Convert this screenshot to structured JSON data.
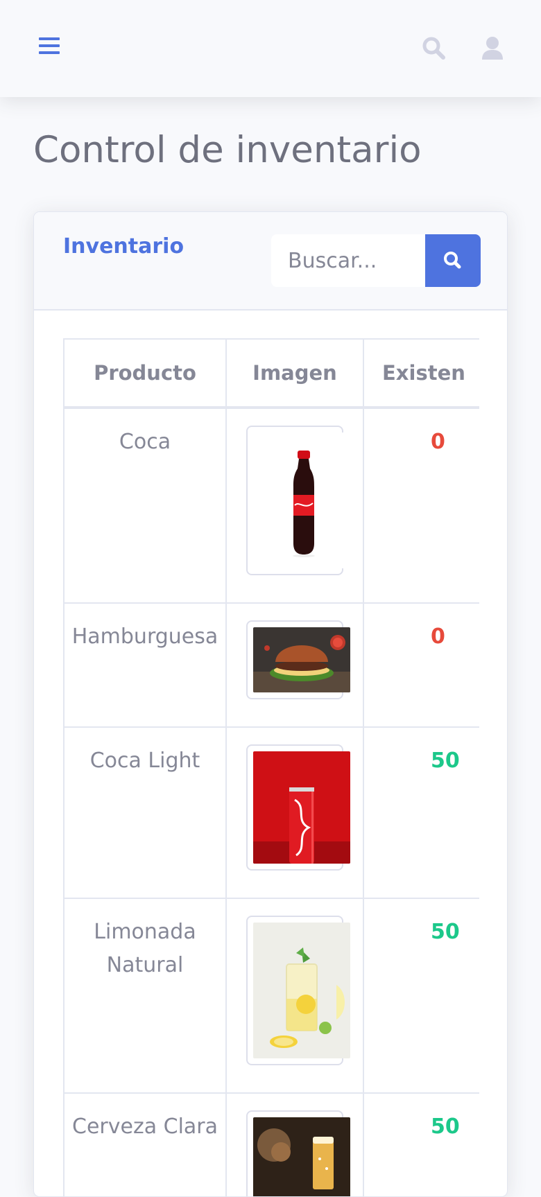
{
  "topbar": {
    "menu_icon": "hamburger-menu-icon",
    "search_icon": "search-icon",
    "user_icon": "user-icon",
    "accent_color": "#4e73df",
    "icon_color": "#d1d3e2"
  },
  "page": {
    "title": "Control de inventario"
  },
  "card": {
    "title": "Inventario",
    "search": {
      "placeholder": "Buscar...",
      "button_icon": "search-icon"
    }
  },
  "table": {
    "headers": [
      "Producto",
      "Imagen",
      "Existen"
    ],
    "rows": [
      {
        "product": "Coca",
        "image": "coca-cola-bottle-image",
        "stock": "0",
        "stock_color": "#e74a3b"
      },
      {
        "product": "Hamburguesa",
        "image": "hamburger-image",
        "stock": "0",
        "stock_color": "#e74a3b"
      },
      {
        "product": "Coca Light",
        "image": "coca-cola-can-image",
        "stock": "50",
        "stock_color": "#1cc88a"
      },
      {
        "product": "Limonada Natural",
        "image": "lemonade-glass-image",
        "stock": "50",
        "stock_color": "#1cc88a"
      },
      {
        "product": "Cerveza Clara",
        "image": "beer-glass-image",
        "stock": "50",
        "stock_color": "#1cc88a"
      }
    ]
  }
}
